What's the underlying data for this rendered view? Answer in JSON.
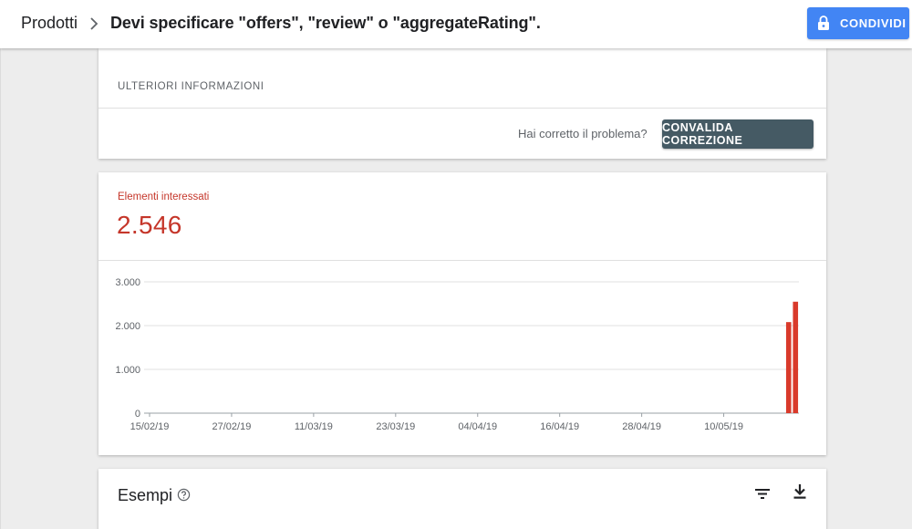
{
  "header": {
    "breadcrumb_root": "Prodotti",
    "title": "Devi specificare \"offers\", \"review\" o \"aggregateRating\".",
    "share_label": "CONDIVIDI",
    "share_icon": "lock-icon",
    "separator_icon": "chevron-right-icon",
    "accent_color": "#4285f4"
  },
  "info_card": {
    "more_info_label": "ULTERIORI INFORMAZIONI",
    "fixed_question": "Hai corretto il problema?",
    "validate_label": "CONVALIDA CORREZIONE",
    "validate_color": "#455a64"
  },
  "metric": {
    "label": "Elementi interessati",
    "value": "2.546",
    "color": "#c5362a"
  },
  "chart_data": {
    "type": "bar",
    "y_ticks": [
      "3.000",
      "2.000",
      "1.000",
      "0"
    ],
    "x_ticks": [
      "15/02/19",
      "27/02/19",
      "11/03/19",
      "23/03/19",
      "04/04/19",
      "16/04/19",
      "28/04/19",
      "10/05/19"
    ],
    "ylim": [
      0,
      3000
    ],
    "x_start": "2019-02-15",
    "x_end": "2019-05-21",
    "series": [
      {
        "values": [
          {
            "date": "2019-05-19",
            "value": 2080
          },
          {
            "date": "2019-05-20",
            "value": 2546
          }
        ]
      }
    ],
    "bar_color": "#d93a2b",
    "grid": true
  },
  "examples": {
    "title": "Esempi",
    "help_icon": "help-circle-icon",
    "filter_icon": "filter-icon",
    "download_icon": "download-icon"
  }
}
